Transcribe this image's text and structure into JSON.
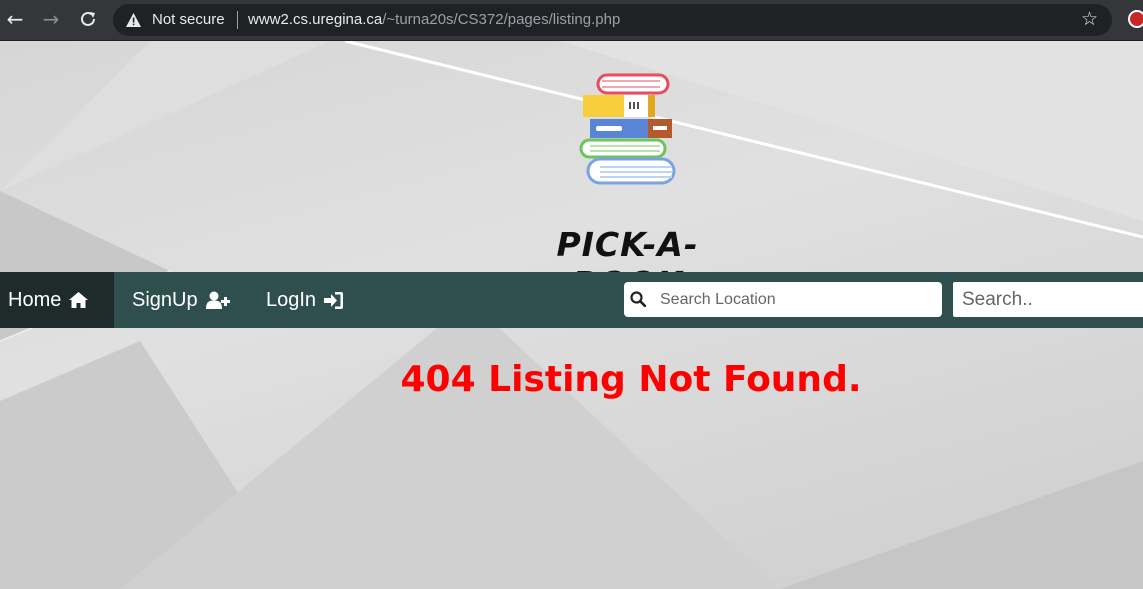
{
  "browser": {
    "security_label": "Not secure",
    "url_host": "www2.cs.uregina.ca",
    "url_path": "/~turna20s/CS372/pages/listing.php",
    "icons": [
      "back-icon",
      "forward-icon",
      "reload-icon",
      "warning-icon",
      "bookmark-star-icon",
      "extension-icon"
    ]
  },
  "site": {
    "logo_text": "PICK-A-BOOK"
  },
  "navbar": {
    "home_label": "Home",
    "signup_label": "SignUp",
    "login_label": "LogIn",
    "location_placeholder": "Search Location",
    "search_placeholder": "Search..",
    "bg_color": "#2f4f4f",
    "active_color": "#1f2b2b"
  },
  "main": {
    "error_message": "404 Listing Not Found.",
    "error_color": "#ff0000"
  }
}
